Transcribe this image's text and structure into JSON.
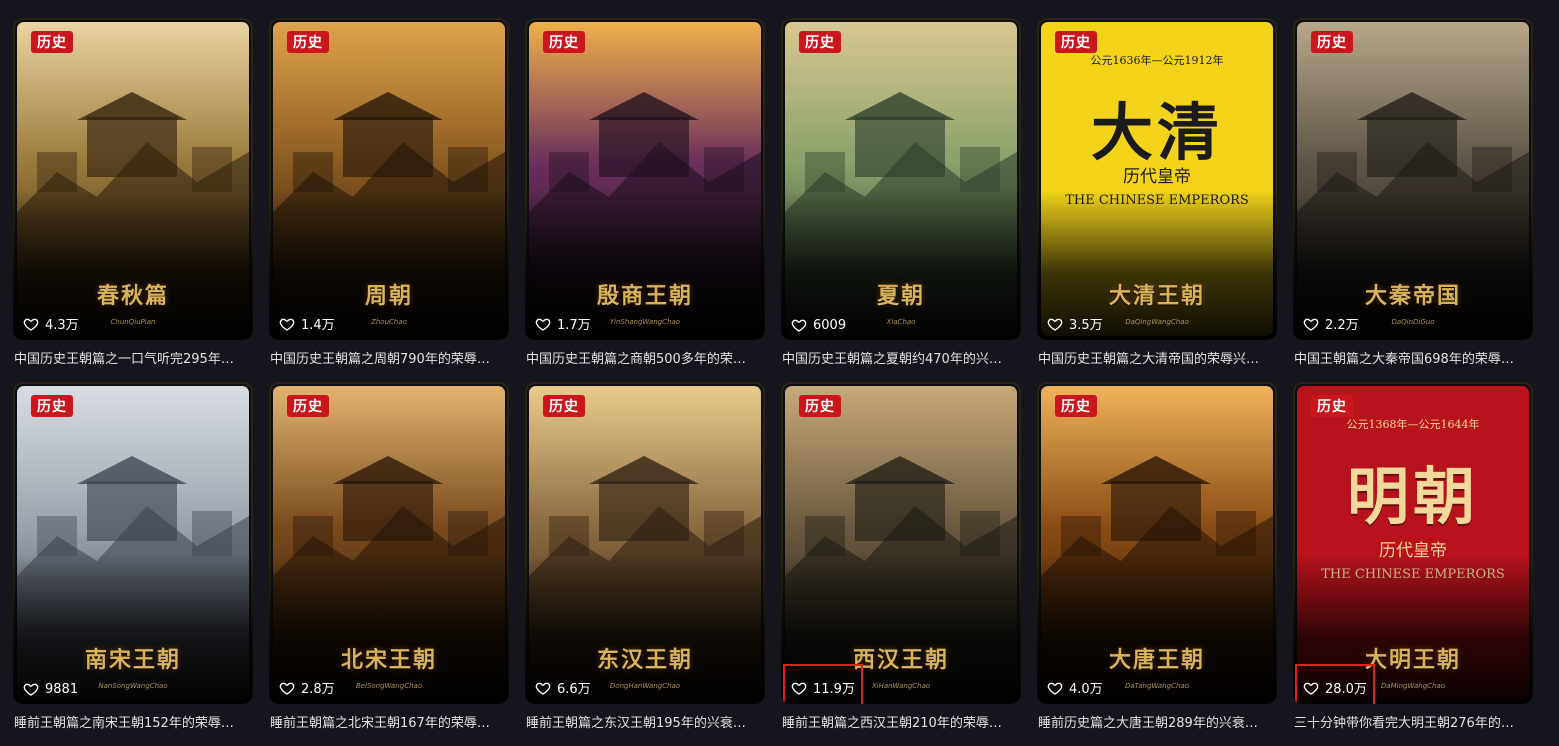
{
  "badge_label": "历史",
  "cards": [
    {
      "title": "春秋篇",
      "pinyin": "ChunQiuPian",
      "likes": "4.3万",
      "caption": "中国历史王朝篇之一口气听完295年…",
      "scene": "scroll"
    },
    {
      "title": "周朝",
      "pinyin": "ZhouChao",
      "likes": "1.4万",
      "caption": "中国历史王朝篇之周朝790年的荣辱…",
      "scene": "scroll2"
    },
    {
      "title": "殷商王朝",
      "pinyin": "YinShangWangChao",
      "likes": "1.7万",
      "caption": "中国历史王朝篇之商朝500多年的荣…",
      "scene": "altar"
    },
    {
      "title": "夏朝",
      "pinyin": "XiaChao",
      "likes": "6009",
      "caption": "中国历史王朝篇之夏朝约470年的兴…",
      "scene": "city"
    },
    {
      "title": "大清王朝",
      "pinyin": "DaQingWangChao",
      "likes": "3.5万",
      "caption": "中国历史王朝篇之大清帝国的荣辱兴…",
      "scene": "poster-yellow",
      "years": "公元1636年—公元1912年",
      "big": "大清",
      "sub": "历代皇帝",
      "eng": "THE CHINESE EMPERORS"
    },
    {
      "title": "大秦帝国",
      "pinyin": "DaQinDiGuo",
      "likes": "2.2万",
      "caption": "中国王朝篇之大秦帝国698年的荣辱…",
      "scene": "palace"
    },
    {
      "title": "南宋王朝",
      "pinyin": "NanSongWangChao",
      "likes": "9881",
      "caption": "睡前王朝篇之南宋王朝152年的荣辱…",
      "scene": "warrior"
    },
    {
      "title": "北宋王朝",
      "pinyin": "BeiSongWangChao",
      "likes": "2.8万",
      "caption": "睡前王朝篇之北宋王朝167年的荣辱…",
      "scene": "market"
    },
    {
      "title": "东汉王朝",
      "pinyin": "DongHanWangChao",
      "likes": "6.6万",
      "caption": "睡前王朝篇之东汉王朝195年的兴衰…",
      "scene": "temple"
    },
    {
      "title": "西汉王朝",
      "pinyin": "XiHanWangChao",
      "likes": "11.9万",
      "caption": "睡前王朝篇之西汉王朝210年的荣辱…",
      "scene": "gate",
      "highlight": true
    },
    {
      "title": "大唐王朝",
      "pinyin": "DaTangWangChao",
      "likes": "4.0万",
      "caption": "睡前历史篇之大唐王朝289年的兴衰…",
      "scene": "golden"
    },
    {
      "title": "大明王朝",
      "pinyin": "DaMingWangChao",
      "likes": "28.0万",
      "caption": "三十分钟带你看完大明王朝276年的…",
      "scene": "poster-red",
      "years": "公元1368年—公元1644年",
      "big": "明朝",
      "sub": "历代皇帝",
      "eng": "THE CHINESE EMPERORS",
      "highlight": true
    }
  ]
}
